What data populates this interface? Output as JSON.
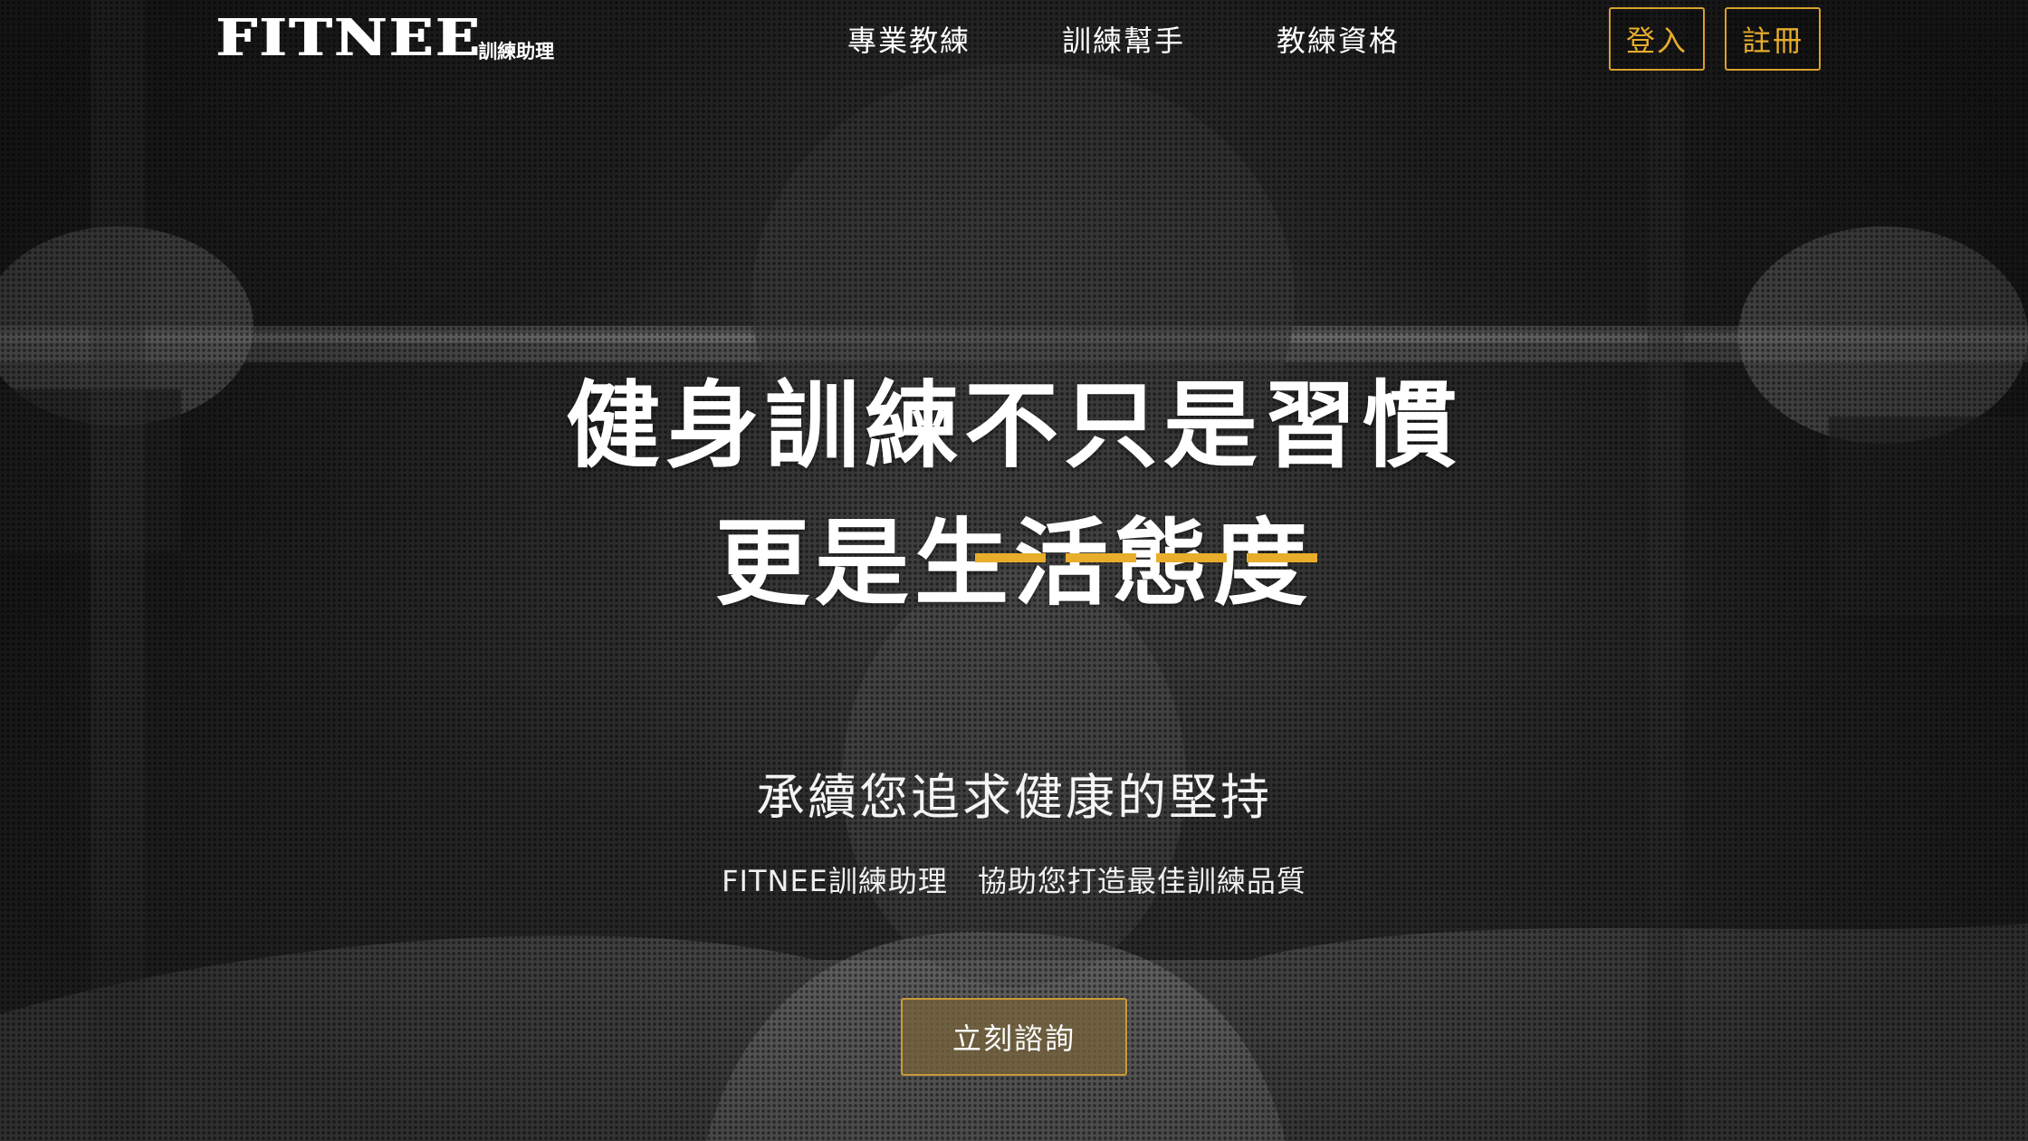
{
  "brand": {
    "logo": "FITNEE",
    "logo_sub": "訓練助理"
  },
  "nav": {
    "items": [
      {
        "label": "專業教練"
      },
      {
        "label": "訓練幫手"
      },
      {
        "label": "教練資格"
      }
    ]
  },
  "auth": {
    "login_label": "登入",
    "signup_label": "註冊"
  },
  "hero": {
    "headline_line1": "健身訓練不只是習慣",
    "headline_line2": "更是生活態度",
    "tagline": "承續您追求健康的堅持",
    "description": "FITNEE訓練助理　協助您打造最佳訓練品質",
    "cta_label": "立刻諮詢"
  },
  "colors": {
    "accent": "#e8ad2a",
    "text": "#ffffff",
    "background": "#1e1e1e"
  },
  "icons": {
    "logo": "fitnee-wordmark"
  }
}
